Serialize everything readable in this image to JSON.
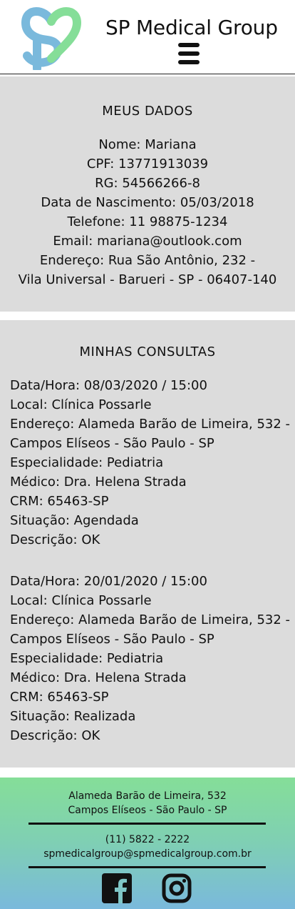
{
  "header": {
    "brand": "SP Medical Group",
    "logo_icon": "sp-heart-logo-icon",
    "menu_icon": "hamburger-menu-icon",
    "logo_colors": [
      "#7ab9dc",
      "#85de98"
    ]
  },
  "dados": {
    "title": "MEUS DADOS",
    "lines": [
      "Nome: Mariana",
      "CPF: 13771913039",
      "RG: 54566266-8",
      "Data de Nascimento: 05/03/2018",
      "Telefone: 11 98875-1234",
      "Email: mariana@outlook.com",
      "Endereço: Rua São Antônio, 232 -",
      "Vila Universal - Barueri - SP - 06407-140"
    ]
  },
  "consultas": {
    "title": "MINHAS CONSULTAS",
    "items": [
      {
        "lines": [
          "Data/Hora: 08/03/2020 / 15:00",
          "Local: Clínica Possarle",
          "Endereço: Alameda Barão de Limeira, 532 -",
          "Campos Elíseos - São Paulo - SP",
          "Especialidade: Pediatria",
          "Médico: Dra. Helena Strada",
          "CRM: 65463-SP",
          "Situação: Agendada",
          "Descrição: OK"
        ]
      },
      {
        "lines": [
          "Data/Hora: 20/01/2020 / 15:00",
          "Local: Clínica Possarle",
          "Endereço: Alameda Barão de Limeira, 532 -",
          "Campos Elíseos - São Paulo - SP",
          "Especialidade: Pediatria",
          "Médico: Dra. Helena Strada",
          "CRM: 65463-SP",
          "Situação: Realizada",
          "Descrição: OK"
        ]
      }
    ]
  },
  "footer": {
    "address_1": "Alameda Barão de Limeira, 532",
    "address_2": "Campos Elíseos - São Paulo - SP",
    "phone": "(11) 5822 - 2222",
    "email": "spmedicalgroup@spmedicalgroup.com.br",
    "social_icons": [
      "facebook-icon",
      "instagram-icon"
    ],
    "gradient": [
      "#85de98",
      "#7ab9dc"
    ]
  }
}
